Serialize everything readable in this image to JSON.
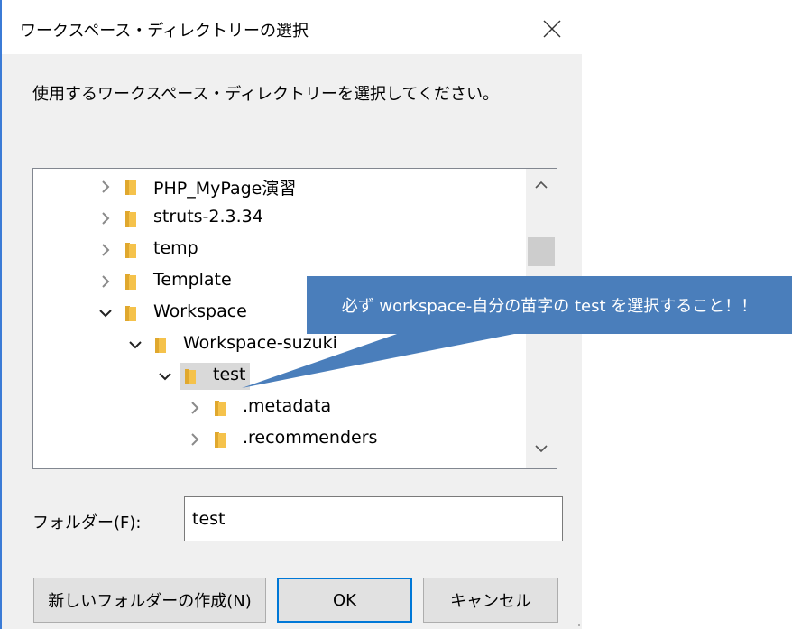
{
  "dialog": {
    "title": "ワークスペース・ディレクトリーの選択",
    "instruction": "使用するワークスペース・ディレクトリーを選択してください。",
    "folder_label": "フォルダー(F):",
    "folder_value": "test",
    "buttons": {
      "new_folder": "新しいフォルダーの作成(N)",
      "ok": "OK",
      "cancel": "キャンセル"
    }
  },
  "tree": {
    "items": [
      {
        "label": "PHP_MyPage演習",
        "expanded": false,
        "level": 0
      },
      {
        "label": "struts-2.3.34",
        "expanded": false,
        "level": 0
      },
      {
        "label": "temp",
        "expanded": false,
        "level": 0
      },
      {
        "label": "Template",
        "expanded": false,
        "level": 0
      },
      {
        "label": "Workspace",
        "expanded": true,
        "level": 0
      },
      {
        "label": "Workspace-suzuki",
        "expanded": true,
        "level": 1
      },
      {
        "label": "test",
        "expanded": true,
        "level": 2,
        "selected": true
      },
      {
        "label": ".metadata",
        "expanded": false,
        "level": 3
      },
      {
        "label": ".recommenders",
        "expanded": false,
        "level": 3
      }
    ]
  },
  "callout": {
    "text": "必ず workspace-自分の苗字の test を選択すること！！",
    "color": "#4a7ebb"
  },
  "colors": {
    "folder": "#f5c24b",
    "accent": "#0078d7"
  }
}
